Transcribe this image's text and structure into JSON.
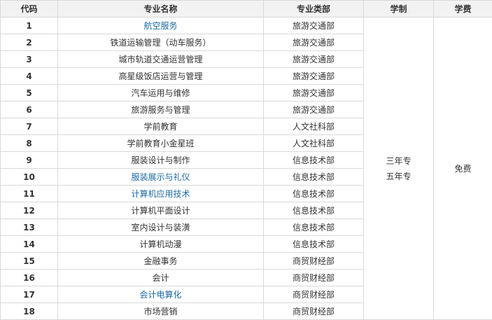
{
  "headers": {
    "code": "代码",
    "name": "专业名称",
    "dept": "专业类部",
    "duration": "学制",
    "fee": "学费"
  },
  "rows": [
    {
      "code": "1",
      "name": "航空服务",
      "dept": "旅游交通部",
      "link": true
    },
    {
      "code": "2",
      "name": "铁道运输管理（动车服务）",
      "dept": "旅游交通部",
      "link": false
    },
    {
      "code": "3",
      "name": "城市轨道交通运营管理",
      "dept": "旅游交通部",
      "link": false
    },
    {
      "code": "4",
      "name": "高星级饭店运营与管理",
      "dept": "旅游交通部",
      "link": false
    },
    {
      "code": "5",
      "name": "汽车运用与维修",
      "dept": "旅游交通部",
      "link": false
    },
    {
      "code": "6",
      "name": "旅游服务与管理",
      "dept": "旅游交通部",
      "link": false
    },
    {
      "code": "7",
      "name": "学前教育",
      "dept": "人文社科部",
      "link": false
    },
    {
      "code": "8",
      "name": "学前教育小金星班",
      "dept": "人文社科部",
      "link": false
    },
    {
      "code": "9",
      "name": "服装设计与制作",
      "dept": "信息技术部",
      "link": false
    },
    {
      "code": "10",
      "name": "服装展示与礼仪",
      "dept": "信息技术部",
      "link": true
    },
    {
      "code": "11",
      "name": "计算机应用技术",
      "dept": "信息技术部",
      "link": true
    },
    {
      "code": "12",
      "name": "计算机平面设计",
      "dept": "信息技术部",
      "link": false
    },
    {
      "code": "13",
      "name": "室内设计与装潢",
      "dept": "信息技术部",
      "link": false
    },
    {
      "code": "14",
      "name": "计算机动漫",
      "dept": "信息技术部",
      "link": false
    },
    {
      "code": "15",
      "name": "金融事务",
      "dept": "商贸财经部",
      "link": false
    },
    {
      "code": "16",
      "name": "会计",
      "dept": "商贸财经部",
      "link": false
    },
    {
      "code": "17",
      "name": "会计电算化",
      "dept": "商贸财经部",
      "link": true
    },
    {
      "code": "18",
      "name": "市场营销",
      "dept": "商贸财经部",
      "link": false
    }
  ],
  "duration": {
    "line1": "三年专",
    "line2": "五年专"
  },
  "fee": "免费",
  "colors": {
    "link": "#1a6aa6",
    "header_bg": "#f2f2f2",
    "border": "#d9d9d9",
    "text": "#333333"
  }
}
